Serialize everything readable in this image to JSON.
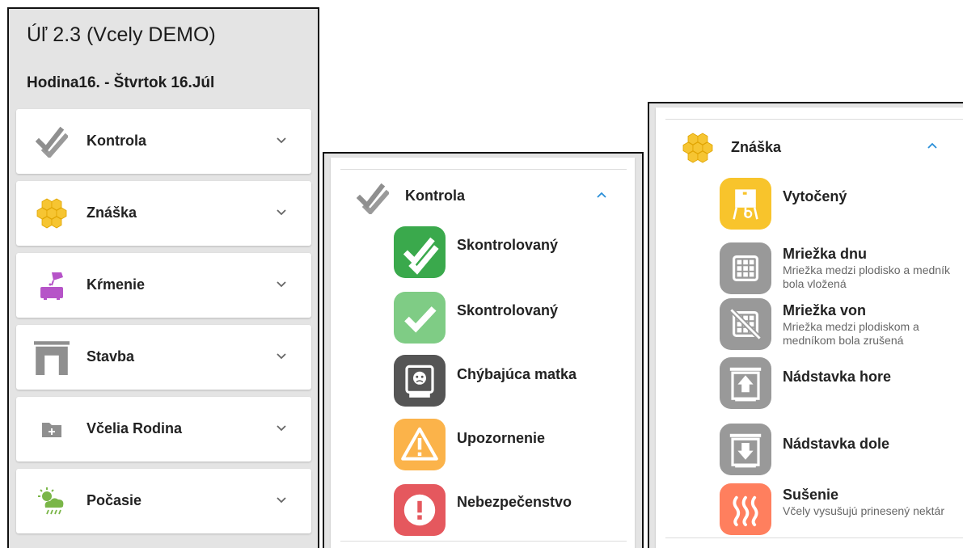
{
  "header": {
    "title": "Úľ 2.3 (Vcely DEMO)",
    "subtitle": "Hodina16. - Štvrtok 16.Júl"
  },
  "menu": {
    "items": [
      {
        "label": "Kontrola",
        "icon": "double-check-icon",
        "color": "#8f8f8f"
      },
      {
        "label": "Znáška",
        "icon": "honeycomb-icon",
        "color": "#f6c532"
      },
      {
        "label": "Kŕmenie",
        "icon": "feeder-icon",
        "color": "#b654c8"
      },
      {
        "label": "Stavba",
        "icon": "frame-icon",
        "color": "#8f8f8f"
      },
      {
        "label": "Včelia Rodina",
        "icon": "folder-plus-icon",
        "color": "#8f8f8f"
      },
      {
        "label": "Počasie",
        "icon": "weather-icon",
        "color": "#7ab648"
      }
    ]
  },
  "kontrola_panel": {
    "title": "Kontrola",
    "items": [
      {
        "label": "Skontrolovaný",
        "icon": "double-check-icon",
        "color": "#3aa94c"
      },
      {
        "label": "Skontrolovaný",
        "icon": "check-icon",
        "color": "#7fcc85"
      },
      {
        "label": "Chýbajúca matka",
        "icon": "hive-sad-icon",
        "color": "#555555"
      },
      {
        "label": "Upozornenie",
        "icon": "warning-icon",
        "color": "#fbb34a"
      },
      {
        "label": "Nebezpečenstvo",
        "icon": "danger-icon",
        "color": "#e5585e"
      }
    ]
  },
  "znaska_panel": {
    "title": "Znáška",
    "items": [
      {
        "label": "Vytočený",
        "description": "",
        "icon": "extractor-icon",
        "color": "#f8c42c"
      },
      {
        "label": "Mriežka dnu",
        "description": "Mriežka medzi plodisko a medník bola vložená",
        "icon": "grid-icon",
        "color": "#999999"
      },
      {
        "label": "Mriežka von",
        "description": "Mriežka medzi plodiskom a medníkom bola zrušená",
        "icon": "grid-off-icon",
        "color": "#999999"
      },
      {
        "label": "Nádstavka hore",
        "description": "",
        "icon": "super-up-icon",
        "color": "#999999"
      },
      {
        "label": "Nádstavka dole",
        "description": "",
        "icon": "super-down-icon",
        "color": "#999999"
      },
      {
        "label": "Sušenie",
        "description": "Včely vysušujú prinesený nektár",
        "icon": "heat-icon",
        "color": "#ff7f5e"
      }
    ]
  },
  "colors": {
    "accent_chevron": "#2a8fd8",
    "background": "#e4e4e4",
    "card": "#ffffff"
  }
}
